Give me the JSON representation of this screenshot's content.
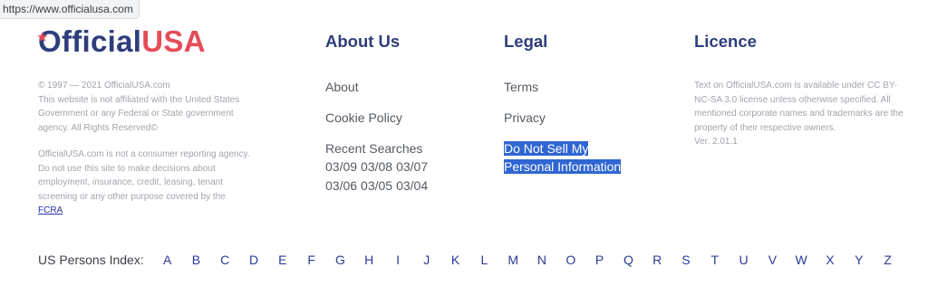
{
  "tooltip_url": "https://www.officialusa.com",
  "logo": {
    "official": "fficial",
    "usa": "USA"
  },
  "left": {
    "copyright": "© 1997 — 2021 OfficialUSA.com",
    "affiliation": "This website is not affiliated with the United States Government or any Federal or State government agency. All Rights Reserved©",
    "disclaimer_before": "OfficialUSA.com is not a consumer reporting agency. Do not use this site to make decisions about employment, insurance, credit, leasing, tenant screening or any other purpose covered by the",
    "fcra": "FCRA"
  },
  "about": {
    "heading": "About Us",
    "links": [
      "About",
      "Cookie Policy"
    ],
    "recent_title": "Recent Searches",
    "recent_dates": [
      "03/09",
      "03/08",
      "03/07",
      "03/06",
      "03/05",
      "03/04"
    ]
  },
  "legal": {
    "heading": "Legal",
    "links": [
      "Terms",
      "Privacy"
    ],
    "highlight_line1": "Do Not Sell My",
    "highlight_line2": "Personal Information"
  },
  "licence": {
    "heading": "Licence",
    "text": "Text on OfficialUSA.com is available under CC BY-NC-SA 3.0 license unless otherwise specified. All mentioned corporate names and trademarks are the property of their respective owners.",
    "version": "Ver. 2.01.1"
  },
  "index": {
    "label": "US Persons Index:",
    "letters": [
      "A",
      "B",
      "C",
      "D",
      "E",
      "F",
      "G",
      "H",
      "I",
      "J",
      "K",
      "L",
      "M",
      "N",
      "O",
      "P",
      "Q",
      "R",
      "S",
      "T",
      "U",
      "V",
      "W",
      "X",
      "Y",
      "Z"
    ]
  },
  "colors": {
    "brand_navy": "#2d3e7a",
    "brand_red": "#e64b58",
    "link_blue": "#2a3a96",
    "selection": "#2f66d2"
  }
}
